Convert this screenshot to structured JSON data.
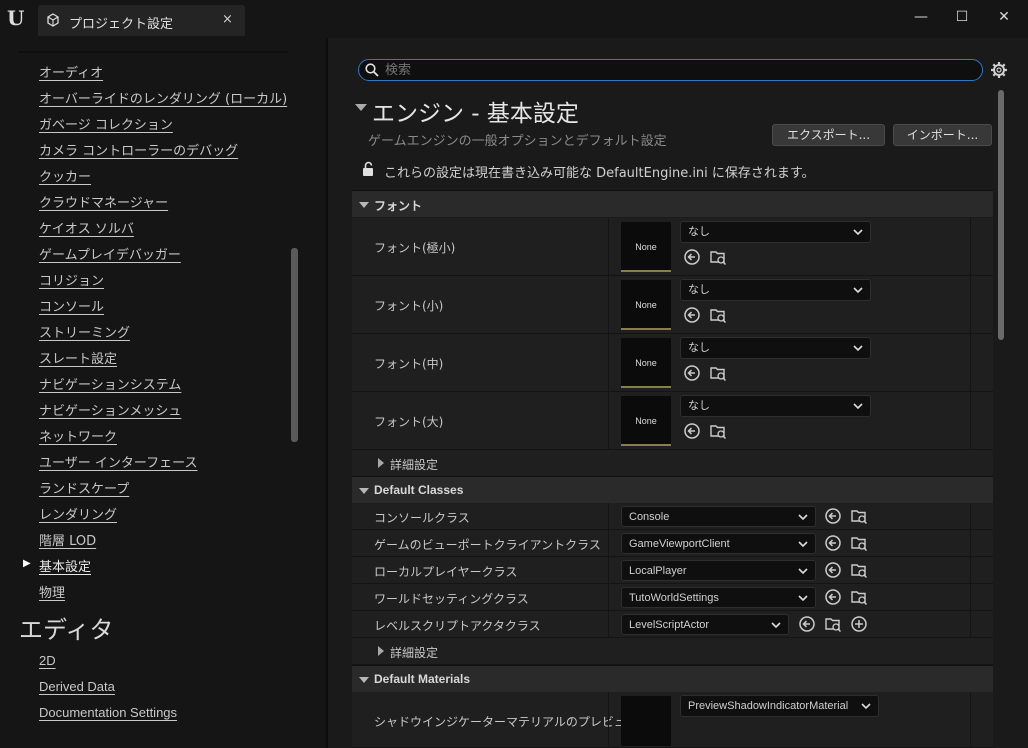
{
  "window": {
    "tab_title": "プロジェクト設定",
    "tab_close": "×",
    "minimize": "—",
    "maximize": "☐",
    "close": "✕",
    "logo": "U"
  },
  "sidebar": {
    "items": [
      {
        "label": "オーディオ"
      },
      {
        "label": "オーバーライドのレンダリング (ローカル)"
      },
      {
        "label": "ガベージ コレクション"
      },
      {
        "label": "カメラ コントローラーのデバッグ"
      },
      {
        "label": "クッカー"
      },
      {
        "label": "クラウドマネージャー"
      },
      {
        "label": "ケイオス ソルバ"
      },
      {
        "label": "ゲームプレイデバッガー"
      },
      {
        "label": "コリジョン"
      },
      {
        "label": "コンソール"
      },
      {
        "label": "ストリーミング"
      },
      {
        "label": "スレート設定"
      },
      {
        "label": "ナビゲーションシステム"
      },
      {
        "label": "ナビゲーションメッシュ"
      },
      {
        "label": "ネットワーク"
      },
      {
        "label": "ユーザー インターフェース"
      },
      {
        "label": "ランドスケープ"
      },
      {
        "label": "レンダリング"
      },
      {
        "label": "階層 LOD"
      },
      {
        "label": "基本設定",
        "selected": true
      },
      {
        "label": "物理"
      }
    ],
    "editor_heading": "エディタ",
    "editor_items": [
      {
        "label": "2D"
      },
      {
        "label": "Derived Data"
      },
      {
        "label": "Documentation Settings"
      }
    ]
  },
  "main": {
    "search_placeholder": "検索",
    "section_title": "エンジン - 基本設定",
    "section_desc": "ゲームエンジンの一般オプションとデフォルト設定",
    "export_label": "エクスポート...",
    "import_label": "インポート...",
    "save_notice": "これらの設定は現在書き込み可能な DefaultEngine.ini に保存されます。",
    "categories": {
      "font": "フォント",
      "default_classes": "Default Classes",
      "default_materials": "Default Materials"
    },
    "font_rows": [
      {
        "label": "フォント(極小)",
        "thumb": "None",
        "value": "なし"
      },
      {
        "label": "フォント(小)",
        "thumb": "None",
        "value": "なし"
      },
      {
        "label": "フォント(中)",
        "thumb": "None",
        "value": "なし"
      },
      {
        "label": "フォント(大)",
        "thumb": "None",
        "value": "なし"
      }
    ],
    "advanced_label": "詳細設定",
    "class_rows": [
      {
        "label": "コンソールクラス",
        "value": "Console"
      },
      {
        "label": "ゲームのビューポートクライアントクラス",
        "value": "GameViewportClient"
      },
      {
        "label": "ローカルプレイヤークラス",
        "value": "LocalPlayer"
      },
      {
        "label": "ワールドセッティングクラス",
        "value": "TutoWorldSettings"
      },
      {
        "label": "レベルスクリプトアクタクラス",
        "value": "LevelScriptActor"
      }
    ],
    "material_rows": [
      {
        "label": "シャドウインジケーターマテリアルのプレビュー",
        "value": "PreviewShadowIndicatorMaterial"
      }
    ]
  },
  "colors": {
    "accent": "#2f77c9",
    "thumb_underline": "#8a7e4a"
  }
}
